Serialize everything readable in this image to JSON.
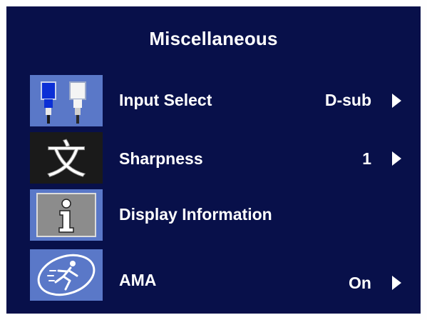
{
  "menu": {
    "title": "Miscellaneous",
    "items": [
      {
        "icon": "input-connector-icon",
        "label": "Input Select",
        "value": "D-sub",
        "has_arrow": true
      },
      {
        "icon": "sharpness-text-icon",
        "label": "Sharpness",
        "value": "1",
        "has_arrow": true
      },
      {
        "icon": "information-icon",
        "label": "Display Information",
        "value": "",
        "has_arrow": false
      },
      {
        "icon": "ama-runner-icon",
        "label": "AMA",
        "value": "On",
        "has_arrow": true
      }
    ]
  },
  "colors": {
    "panel_background": "#08104a",
    "text": "#ffffff",
    "icon_blue": "#5a78c8"
  }
}
